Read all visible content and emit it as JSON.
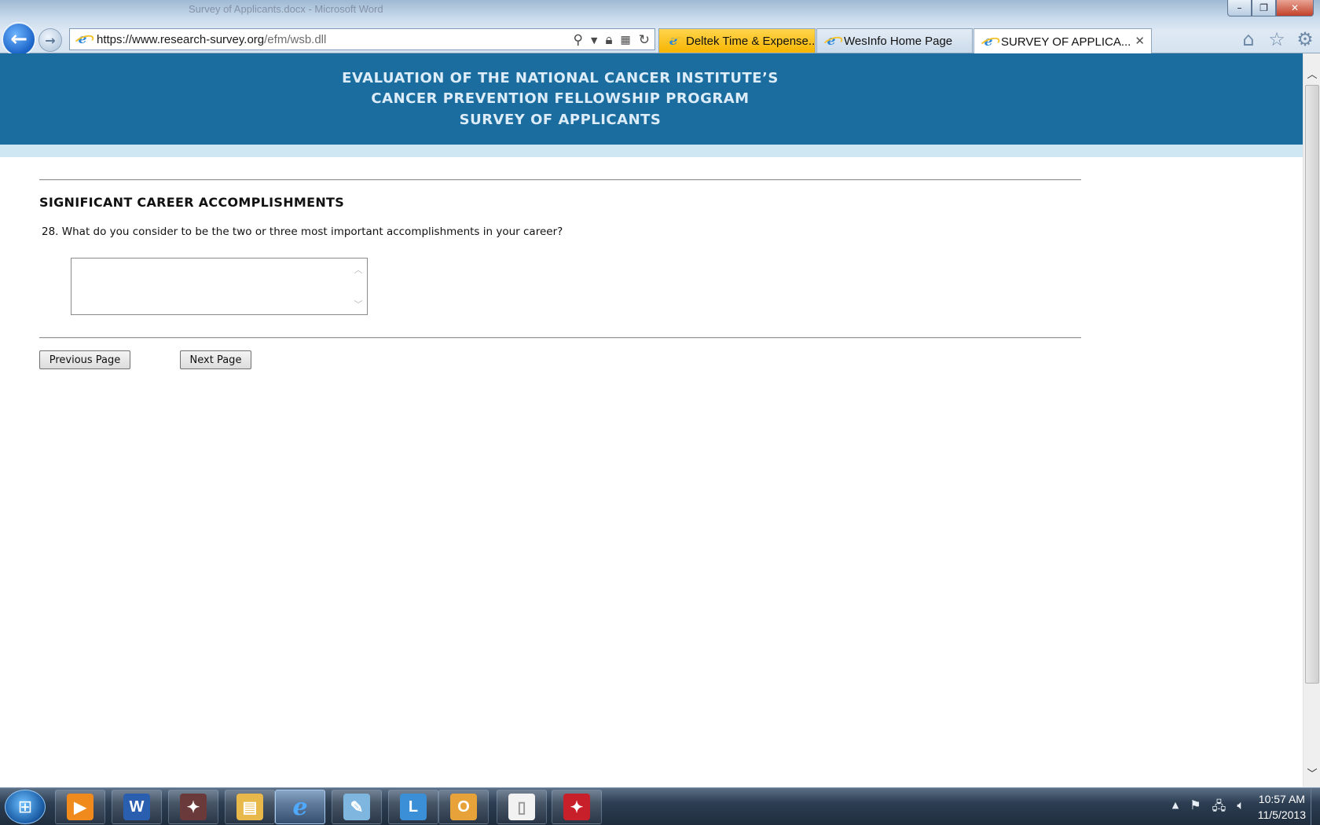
{
  "window": {
    "title": "Survey of Applicants.docx - Microsoft Word",
    "controls": {
      "minimize": "–",
      "restore": "❐",
      "close": "✕"
    }
  },
  "browser": {
    "address": {
      "url_main": "https://www.research-survey.org",
      "url_path": "/efm/wsb.dll"
    },
    "tabs": [
      {
        "label": "Deltek Time & Expense...",
        "active": false,
        "color": "#f6b400"
      },
      {
        "label": "WesInfo Home Page",
        "active": false
      },
      {
        "label": "SURVEY OF APPLICA...",
        "active": true
      }
    ],
    "icons": [
      "back-icon",
      "forward-icon",
      "search-icon",
      "lock-icon",
      "compat-icon",
      "refresh-icon",
      "home-icon",
      "favorites-icon",
      "tools-icon"
    ]
  },
  "banner": {
    "line1": "EVALUATION OF THE NATIONAL CANCER INSTITUTE’S",
    "line2": "CANCER PREVENTION FELLOWSHIP PROGRAM",
    "line3": "SURVEY OF APPLICANTS",
    "bg_color": "#1a6d9e"
  },
  "section": {
    "title": "SIGNIFICANT CAREER ACCOMPLISHMENTS",
    "question": "28. What do you consider to be the two or three most important accomplishments in your career?",
    "answer_value": ""
  },
  "buttons": {
    "previous": "Previous Page",
    "next": "Next Page"
  },
  "taskbar": {
    "items": [
      "media-player-icon",
      "word-icon",
      "acrobat-icon",
      "explorer-icon",
      "ie-icon",
      "notepad-icon",
      "lync-icon",
      "outlook-icon",
      "blank-doc-icon",
      "pdf-icon"
    ],
    "clock_time": "10:57 AM",
    "clock_date": "11/5/2013"
  }
}
